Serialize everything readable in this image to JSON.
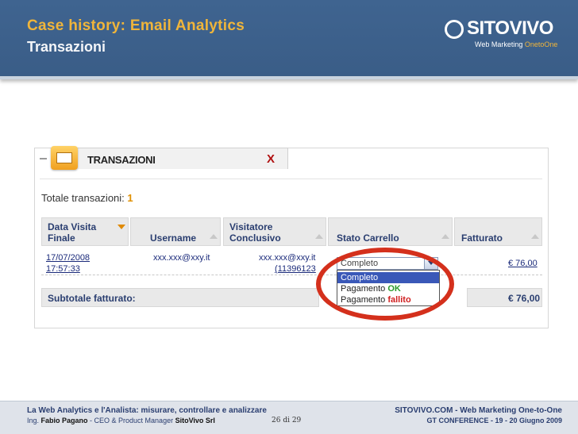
{
  "header": {
    "title": "Case history: Email Analytics",
    "subtitle": "Transazioni",
    "logo": {
      "name": "SITOVIVO",
      "tag_prefix": "Web Marketing ",
      "tag_accent": "OnetoOne"
    }
  },
  "panel": {
    "tab_title": "TRANSAZIONI",
    "close_label": "X",
    "total_label": "Totale transazioni: ",
    "total_value": "1",
    "columns": [
      {
        "line1": "Data Visita",
        "line2": "Finale"
      },
      {
        "line1": "Username",
        "line2": ""
      },
      {
        "line1": "Visitatore",
        "line2": "Conclusivo"
      },
      {
        "line1": "Stato Carrello",
        "line2": ""
      },
      {
        "line1": "Fatturato",
        "line2": ""
      }
    ],
    "row": {
      "date": "17/07/2008",
      "time": "17:57:33",
      "username": "xxx.xxx@xxy.it",
      "visitor_email": "xxx.xxx@xxy.it",
      "visitor_id": "(11396123",
      "amount": "€ 76,00"
    },
    "status_select": {
      "value": "Completo",
      "options": [
        {
          "label": "Completo",
          "suffix": ""
        },
        {
          "label": "Pagamento ",
          "suffix": "OK"
        },
        {
          "label": "Pagamento ",
          "suffix": "fallito"
        }
      ]
    },
    "subtotal_label": "Subtotale fatturato:",
    "subtotal_value": "€ 76,00"
  },
  "colors": {
    "accent": "#f0b53a",
    "header_bg": "#3f6490",
    "ring": "#d4301c"
  },
  "footer": {
    "left_line1": "La Web Analytics e l'Analista: misurare, controllare e analizzare",
    "left_line2_a": "Ing. ",
    "left_line2_b": "Fabio Pagano",
    "left_line2_c": " - CEO & Product Manager ",
    "left_line2_d": "SitoVivo Srl",
    "page": "26 di 29",
    "right_line1": "SITOVIVO.COM - Web Marketing One-to-One",
    "right_line2": "GT CONFERENCE - 19 - 20 Giugno 2009"
  }
}
